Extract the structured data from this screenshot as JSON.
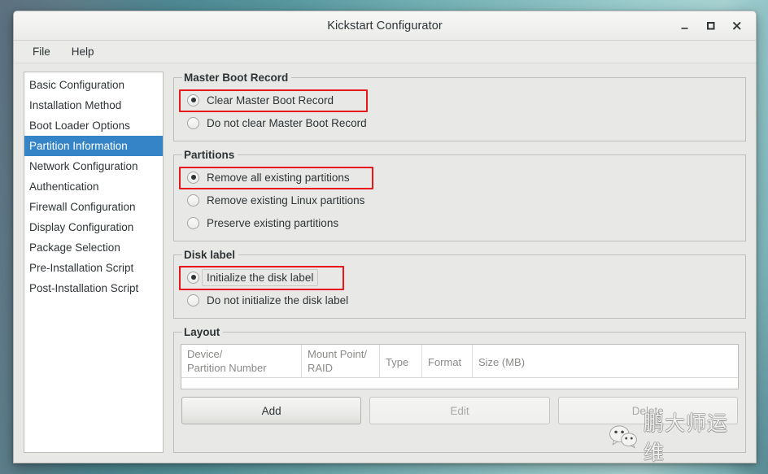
{
  "window": {
    "title": "Kickstart Configurator",
    "minimize_label": "minimize",
    "maximize_label": "maximize",
    "close_label": "close"
  },
  "menubar": {
    "items": [
      {
        "label": "File"
      },
      {
        "label": "Help"
      }
    ]
  },
  "sidebar": {
    "items": [
      {
        "label": "Basic Configuration",
        "selected": false
      },
      {
        "label": "Installation Method",
        "selected": false
      },
      {
        "label": "Boot Loader Options",
        "selected": false
      },
      {
        "label": "Partition Information",
        "selected": true
      },
      {
        "label": "Network Configuration",
        "selected": false
      },
      {
        "label": "Authentication",
        "selected": false
      },
      {
        "label": "Firewall Configuration",
        "selected": false
      },
      {
        "label": "Display Configuration",
        "selected": false
      },
      {
        "label": "Package Selection",
        "selected": false
      },
      {
        "label": "Pre-Installation Script",
        "selected": false
      },
      {
        "label": "Post-Installation Script",
        "selected": false
      }
    ],
    "selected_index": 3,
    "selection_color": "#3584c8"
  },
  "master_boot_record": {
    "legend": "Master Boot Record",
    "options": [
      {
        "label": "Clear Master Boot Record",
        "checked": true,
        "annotated": true
      },
      {
        "label": "Do not clear Master Boot Record",
        "checked": false,
        "annotated": false
      }
    ]
  },
  "partitions": {
    "legend": "Partitions",
    "options": [
      {
        "label": "Remove all existing partitions",
        "checked": true,
        "annotated": true
      },
      {
        "label": "Remove existing Linux partitions",
        "checked": false,
        "annotated": false
      },
      {
        "label": "Preserve existing partitions",
        "checked": false,
        "annotated": false
      }
    ]
  },
  "disk_label": {
    "legend": "Disk label",
    "options": [
      {
        "label": "Initialize the disk label",
        "checked": true,
        "annotated": true,
        "focused": true
      },
      {
        "label": "Do not initialize the disk label",
        "checked": false,
        "annotated": false,
        "focused": false
      }
    ]
  },
  "layout": {
    "legend": "Layout",
    "table": {
      "columns": [
        "Device/\nPartition Number",
        "Mount Point/\nRAID",
        "Type",
        "Format",
        "Size (MB)"
      ],
      "rows": []
    },
    "buttons": [
      {
        "label": "Add",
        "enabled": true,
        "annotated": true
      },
      {
        "label": "Edit",
        "enabled": false,
        "annotated": false
      },
      {
        "label": "Delete",
        "enabled": false,
        "annotated": false
      }
    ]
  },
  "watermark": {
    "text": "鹏大师运维",
    "logo": "wechat-icon"
  },
  "colors": {
    "annotation": "#e8171b",
    "selection": "#3584c8",
    "window_bg": "#e8e8e6",
    "text": "#2e3436"
  }
}
